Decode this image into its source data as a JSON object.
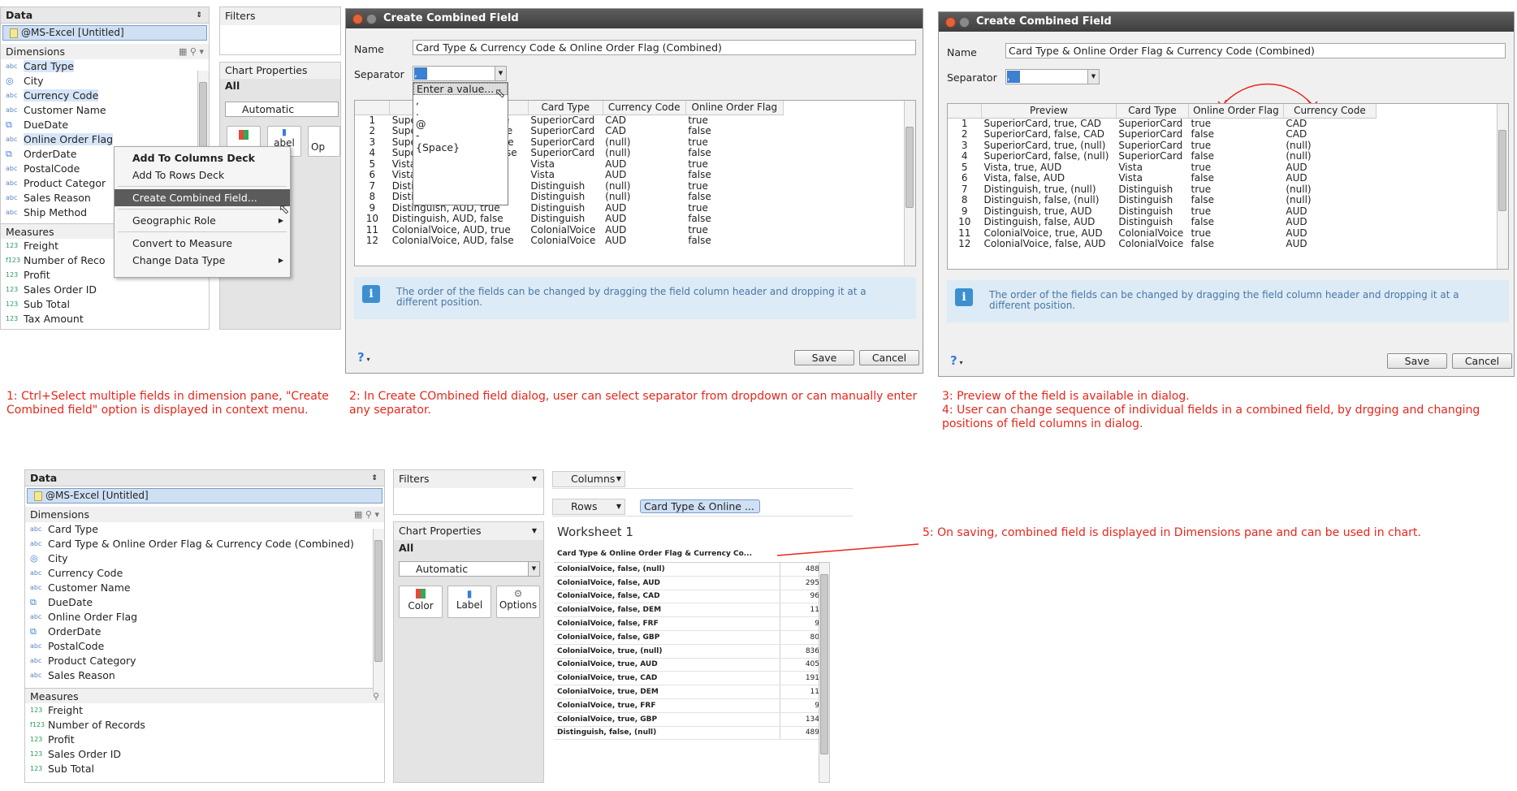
{
  "panel1": {
    "data_header": "Data",
    "datasource": "@MS-Excel [Untitled]",
    "dimensions_header": "Dimensions",
    "dimensions": [
      {
        "icon": "abc",
        "label": "Card Type",
        "selected": true
      },
      {
        "icon": "geo",
        "label": "City",
        "selected": false
      },
      {
        "icon": "abc",
        "label": "Currency Code",
        "selected": true
      },
      {
        "icon": "abc",
        "label": "Customer Name",
        "selected": false
      },
      {
        "icon": "date",
        "label": "DueDate",
        "selected": false
      },
      {
        "icon": "abc",
        "label": "Online Order Flag",
        "selected": true
      },
      {
        "icon": "date",
        "label": "OrderDate",
        "selected": false
      },
      {
        "icon": "abc",
        "label": "PostalCode",
        "selected": false
      },
      {
        "icon": "abc",
        "label": "Product Categor",
        "selected": false
      },
      {
        "icon": "abc",
        "label": "Sales Reason",
        "selected": false
      },
      {
        "icon": "abc",
        "label": "Ship Method",
        "selected": false
      }
    ],
    "measures_header": "Measures",
    "measures": [
      {
        "icon": "123",
        "label": "Freight"
      },
      {
        "icon": "f123",
        "label": "Number of Reco"
      },
      {
        "icon": "123",
        "label": "Profit"
      },
      {
        "icon": "123",
        "label": "Sales Order ID"
      },
      {
        "icon": "123",
        "label": "Sub Total"
      },
      {
        "icon": "123",
        "label": "Tax Amount"
      }
    ],
    "filters_label": "Filters",
    "chart_props_label": "Chart Properties",
    "all_label": "All",
    "automatic_label": "Automatic",
    "label_button": "abel",
    "options_button_partial": "Op",
    "context_menu": [
      {
        "label": "Add To Columns Deck",
        "bold": true,
        "arrow": false
      },
      {
        "label": "Add To Rows Deck",
        "bold": false,
        "arrow": false
      },
      {
        "label": "Create Combined Field...",
        "bold": false,
        "arrow": false,
        "active": true
      },
      {
        "label": "Geographic Role",
        "bold": false,
        "arrow": true
      },
      {
        "label": "Convert to Measure",
        "bold": false,
        "arrow": false
      },
      {
        "label": "Change Data Type",
        "bold": false,
        "arrow": true
      }
    ]
  },
  "dialog1": {
    "title": "Create Combined Field",
    "name_label": "Name",
    "name_value": "Card Type & Currency Code & Online Order Flag (Combined)",
    "separator_label": "Separator",
    "separator_value": ",",
    "dropdown_options": [
      "Enter a value...",
      ",",
      ".",
      "@",
      "-",
      "{Space}"
    ],
    "columns": [
      "",
      "Preview",
      "Card Type",
      "Currency Code",
      "Online Order Flag"
    ],
    "rows": [
      [
        "1",
        "SuperiorCard, CAD, true",
        "SuperiorCard",
        "CAD",
        "true"
      ],
      [
        "2",
        "SuperiorCard, CAD, false",
        "SuperiorCard",
        "CAD",
        "false"
      ],
      [
        "3",
        "SuperiorCard, (null), true",
        "SuperiorCard",
        "(null)",
        "true"
      ],
      [
        "4",
        "SuperiorCard, (null), false",
        "SuperiorCard",
        "(null)",
        "false"
      ],
      [
        "5",
        "Vista, AUD, true",
        "Vista",
        "AUD",
        "true"
      ],
      [
        "6",
        "Vista, AUD, false",
        "Vista",
        "AUD",
        "false"
      ],
      [
        "7",
        "Distinguish, (null), true",
        "Distinguish",
        "(null)",
        "true"
      ],
      [
        "8",
        "Distinguish, (null), false",
        "Distinguish",
        "(null)",
        "false"
      ],
      [
        "9",
        "Distinguish, AUD, true",
        "Distinguish",
        "AUD",
        "true"
      ],
      [
        "10",
        "Distinguish, AUD, false",
        "Distinguish",
        "AUD",
        "false"
      ],
      [
        "11",
        "ColonialVoice, AUD, true",
        "ColonialVoice",
        "AUD",
        "true"
      ],
      [
        "12",
        "ColonialVoice, AUD, false",
        "ColonialVoice",
        "AUD",
        "false"
      ]
    ],
    "info_text": "The order of the fields can be changed by dragging the field column header and dropping it at a different position.",
    "help_label": "?",
    "save_label": "Save",
    "cancel_label": "Cancel"
  },
  "dialog2": {
    "title": "Create Combined Field",
    "name_label": "Name",
    "name_value": "Card Type & Online Order Flag & Currency Code (Combined)",
    "separator_label": "Separator",
    "separator_value": ",",
    "columns": [
      "",
      "Preview",
      "Card Type",
      "Online Order Flag",
      "Currency Code"
    ],
    "rows": [
      [
        "1",
        "SuperiorCard, true, CAD",
        "SuperiorCard",
        "true",
        "CAD"
      ],
      [
        "2",
        "SuperiorCard, false, CAD",
        "SuperiorCard",
        "false",
        "CAD"
      ],
      [
        "3",
        "SuperiorCard, true, (null)",
        "SuperiorCard",
        "true",
        "(null)"
      ],
      [
        "4",
        "SuperiorCard, false, (null)",
        "SuperiorCard",
        "false",
        "(null)"
      ],
      [
        "5",
        "Vista, true, AUD",
        "Vista",
        "true",
        "AUD"
      ],
      [
        "6",
        "Vista, false, AUD",
        "Vista",
        "false",
        "AUD"
      ],
      [
        "7",
        "Distinguish, true, (null)",
        "Distinguish",
        "true",
        "(null)"
      ],
      [
        "8",
        "Distinguish, false, (null)",
        "Distinguish",
        "false",
        "(null)"
      ],
      [
        "9",
        "Distinguish, true, AUD",
        "Distinguish",
        "true",
        "AUD"
      ],
      [
        "10",
        "Distinguish, false, AUD",
        "Distinguish",
        "false",
        "AUD"
      ],
      [
        "11",
        "ColonialVoice, true, AUD",
        "ColonialVoice",
        "true",
        "AUD"
      ],
      [
        "12",
        "ColonialVoice, false, AUD",
        "ColonialVoice",
        "false",
        "AUD"
      ]
    ],
    "info_text": "The order of the fields can be changed by dragging the field column header and dropping it at a different position.",
    "help_label": "?",
    "save_label": "Save",
    "cancel_label": "Cancel"
  },
  "notes": {
    "n1": "1: Ctrl+Select multiple fields in dimension pane, \"Create Combined field\" option is displayed in context menu.",
    "n2": "2: In Create COmbined field dialog, user can select separator from dropdown or can manually enter any separator.",
    "n3": "3: Preview of the field is available in dialog.",
    "n4": "4: User can change sequence of individual fields in a combined field, by drgging and changing positions of field columns in dialog.",
    "n5": "5: On saving, combined field is displayed in Dimensions pane and can be used in chart."
  },
  "panel4": {
    "data_header": "Data",
    "datasource": "@MS-Excel [Untitled]",
    "dimensions_header": "Dimensions",
    "dimensions": [
      {
        "icon": "abc",
        "label": "Card Type"
      },
      {
        "icon": "abc",
        "label": "Card Type & Online Order Flag & Currency Code (Combined)"
      },
      {
        "icon": "geo",
        "label": "City"
      },
      {
        "icon": "abc",
        "label": "Currency Code"
      },
      {
        "icon": "abc",
        "label": "Customer Name"
      },
      {
        "icon": "date",
        "label": "DueDate"
      },
      {
        "icon": "abc",
        "label": "Online Order Flag"
      },
      {
        "icon": "date",
        "label": "OrderDate"
      },
      {
        "icon": "abc",
        "label": "PostalCode"
      },
      {
        "icon": "abc",
        "label": "Product Category"
      },
      {
        "icon": "abc",
        "label": "Sales Reason"
      }
    ],
    "measures_header": "Measures",
    "measures": [
      {
        "icon": "123",
        "label": "Freight"
      },
      {
        "icon": "f123",
        "label": "Number of Records"
      },
      {
        "icon": "123",
        "label": "Profit"
      },
      {
        "icon": "123",
        "label": "Sales Order ID"
      },
      {
        "icon": "123",
        "label": "Sub Total"
      }
    ],
    "filters_label": "Filters",
    "chart_props_label": "Chart Properties",
    "all_label": "All",
    "automatic_label": "Automatic",
    "color_label": "Color",
    "label_label": "Label",
    "options_label": "Options",
    "columns_label": "Columns",
    "rows_label": "Rows",
    "rows_pill": "Card Type & Online ...",
    "worksheet_title": "Worksheet 1",
    "worksheet_header": "Card Type & Online Order Flag & Currency Co...",
    "worksheet_rows": [
      {
        "label": "ColonialVoice, false, (null)",
        "value": "488"
      },
      {
        "label": "ColonialVoice, false, AUD",
        "value": "295"
      },
      {
        "label": "ColonialVoice, false, CAD",
        "value": "96"
      },
      {
        "label": "ColonialVoice, false, DEM",
        "value": "11"
      },
      {
        "label": "ColonialVoice, false, FRF",
        "value": "9"
      },
      {
        "label": "ColonialVoice, false, GBP",
        "value": "80"
      },
      {
        "label": "ColonialVoice, true, (null)",
        "value": "836"
      },
      {
        "label": "ColonialVoice, true, AUD",
        "value": "405"
      },
      {
        "label": "ColonialVoice, true, CAD",
        "value": "191"
      },
      {
        "label": "ColonialVoice, true, DEM",
        "value": "11"
      },
      {
        "label": "ColonialVoice, true, FRF",
        "value": "9"
      },
      {
        "label": "ColonialVoice, true, GBP",
        "value": "134"
      },
      {
        "label": "Distinguish, false, (null)",
        "value": "489"
      }
    ]
  },
  "colors": {
    "annotation": "#e8261c",
    "selection": "#cfe0f5",
    "titlebar": "#4a4a4a",
    "info_bg": "#dcebf5"
  }
}
